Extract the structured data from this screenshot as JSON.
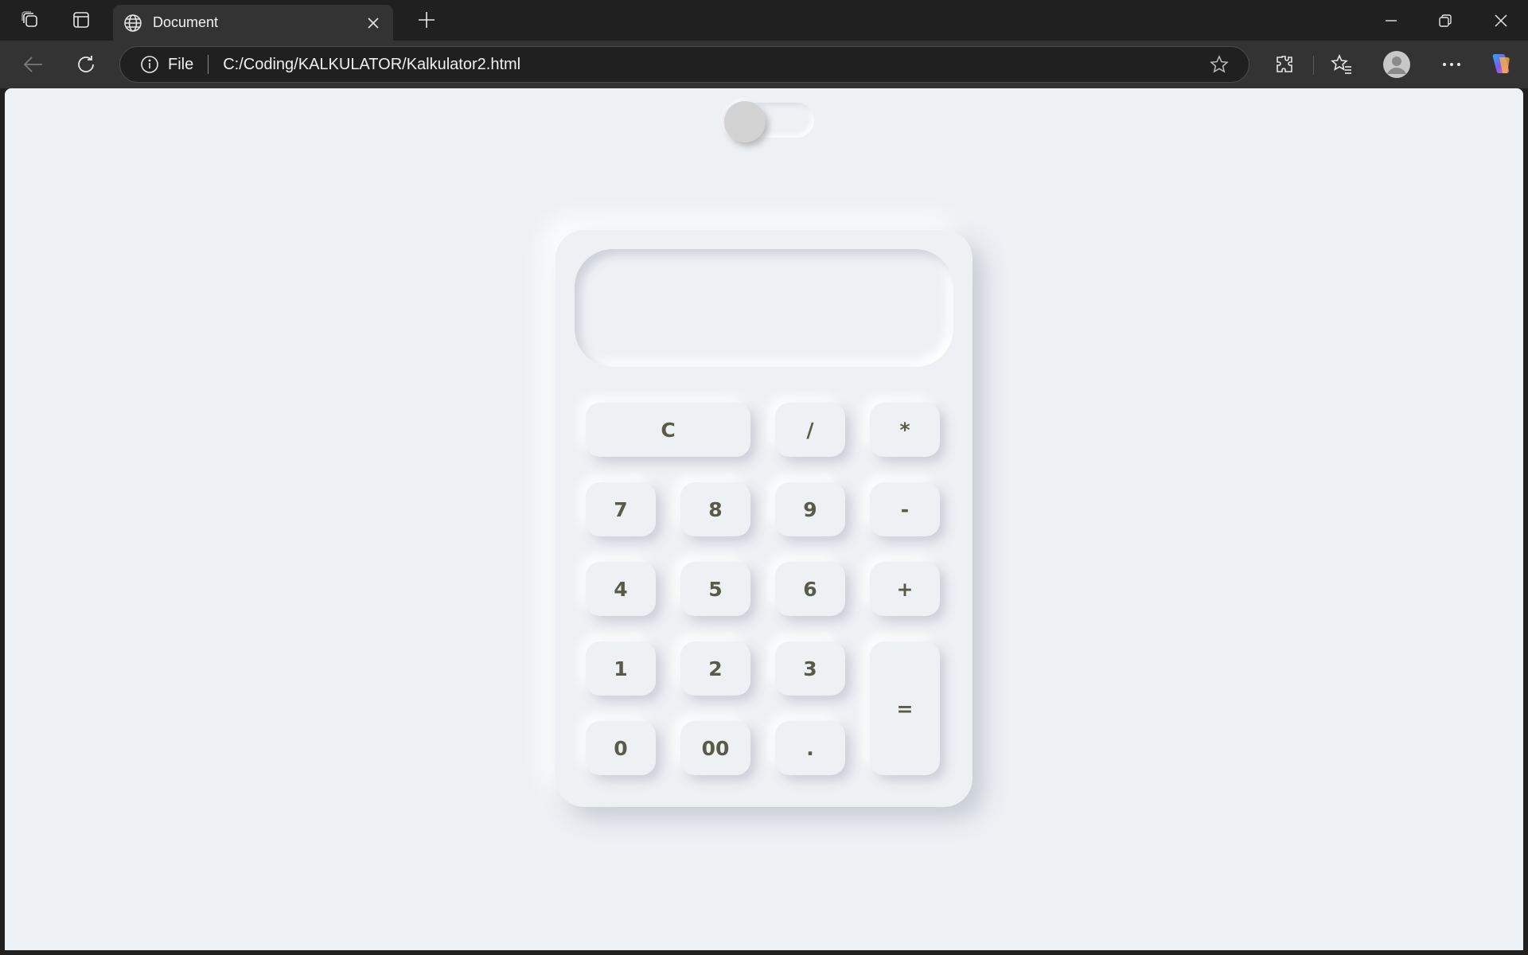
{
  "browser": {
    "tab": {
      "title": "Document"
    },
    "address": {
      "scheme": "File",
      "url": "C:/Coding/KALKULATOR/Kalkulator2.html"
    }
  },
  "page": {
    "theme_toggle": {
      "on": false
    },
    "display": {
      "value": ""
    },
    "keys": {
      "clear": "C",
      "divide": "/",
      "multiply": "*",
      "seven": "7",
      "eight": "8",
      "nine": "9",
      "minus": "-",
      "four": "4",
      "five": "5",
      "six": "6",
      "plus": "+",
      "one": "1",
      "two": "2",
      "three": "3",
      "equals": "=",
      "zero": "0",
      "double_zero": "00",
      "decimal": "."
    }
  },
  "colors": {
    "page_background": "#eef1f4",
    "key_text": "#5a5a48",
    "toggle_knob": "#d2d2d2",
    "chrome_dark": "#202020",
    "chrome_toolbar": "#333333"
  }
}
